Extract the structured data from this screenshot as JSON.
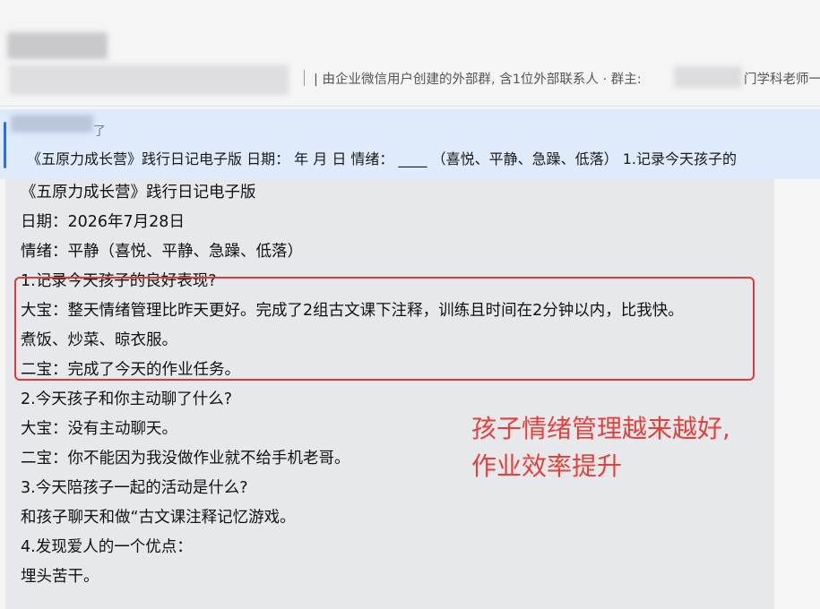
{
  "header": {
    "description": "| 由企业微信用户创建的外部群, 含1位外部联系人 · 群主:",
    "description_tail": "门学科老师一"
  },
  "quote": {
    "sender_suffix": "了",
    "text": "《五原力成长营》践行日记电子版 日期： 年 月 日 情绪： ____ （喜悦、平静、急躁、低落） 1.记录今天孩子的"
  },
  "message": {
    "lines": [
      "《五原力成长营》践行日记电子版",
      "日期：2026年7月28日",
      "情绪：平静（喜悦、平静、急躁、低落）",
      "1.记录今天孩子的良好表现?",
      "大宝：整天情绪管理比昨天更好。完成了2组古文课下注释，训练且时间在2分钟以内，比我快。",
      "煮饭、炒菜、晾衣服。",
      "二宝：完成了今天的作业任务。",
      "2.今天孩子和你主动聊了什么?",
      "大宝：没有主动聊天。",
      "二宝：你不能因为我没做作业就不给手机老哥。",
      "3.今天陪孩子一起的活动是什么?",
      "和孩子聊天和做“古文课注释记忆游戏。",
      "4.发现爱人的一个优点：",
      "埋头苦干。"
    ]
  },
  "annotation": {
    "line1": "孩子情绪管理越来越好,",
    "line2": "作业效率提升"
  }
}
